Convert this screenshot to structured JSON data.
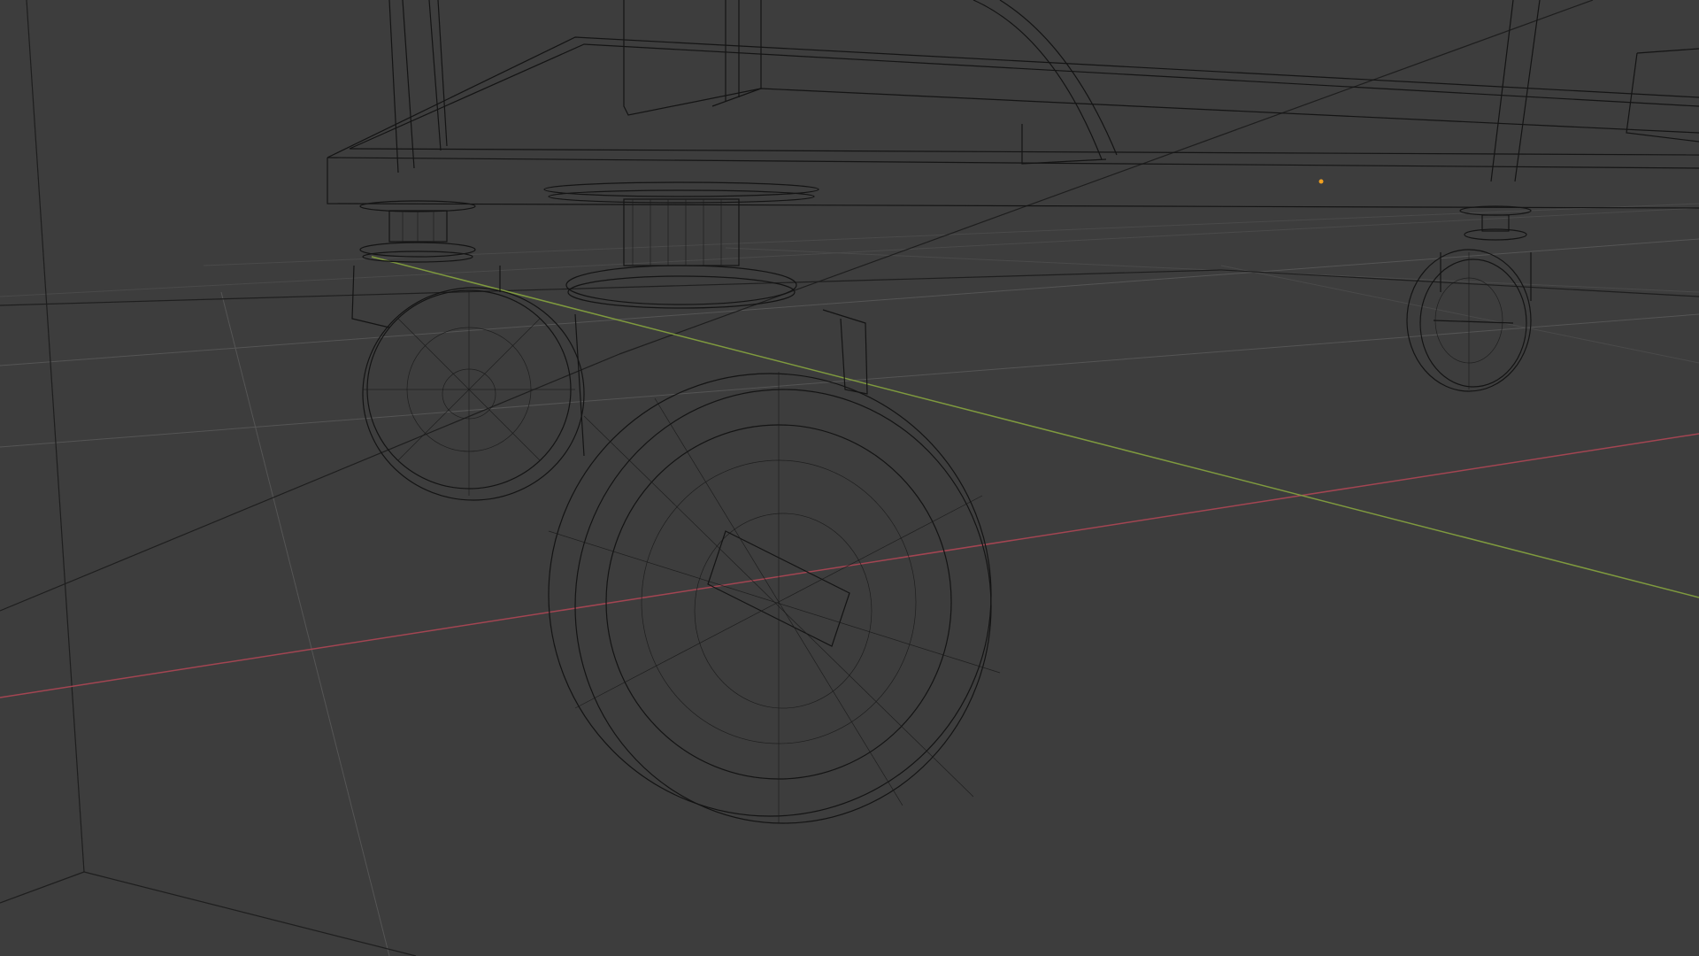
{
  "app": {
    "name": "3D viewport",
    "mode": "wireframe"
  },
  "colors": {
    "background": "#3d3d3d",
    "grid": "#555555",
    "x_axis": "#a34552",
    "y_axis": "#7f9a3e",
    "wireframe": "#141414",
    "origin": "#f0a020"
  },
  "scene": {
    "objects": [
      {
        "name": "cart-base"
      },
      {
        "name": "caster-wheel-front-large"
      },
      {
        "name": "caster-wheel-front-small"
      },
      {
        "name": "caster-wheel-rear-right"
      }
    ]
  }
}
